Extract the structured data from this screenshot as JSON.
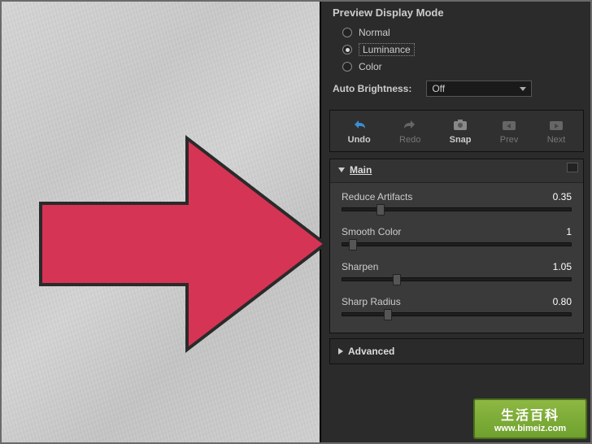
{
  "preview": {
    "title": "Preview Display Mode",
    "options": [
      "Normal",
      "Luminance",
      "Color"
    ],
    "selected": "Luminance",
    "auto_brightness_label": "Auto Brightness:",
    "auto_brightness_value": "Off"
  },
  "toolbar": {
    "undo": "Undo",
    "redo": "Redo",
    "snap": "Snap",
    "prev": "Prev",
    "next": "Next"
  },
  "main": {
    "title": "Main",
    "sliders": [
      {
        "label": "Reduce Artifacts",
        "value": "0.35",
        "pos": 15
      },
      {
        "label": "Smooth Color",
        "value": "1",
        "pos": 3
      },
      {
        "label": "Sharpen",
        "value": "1.05",
        "pos": 22
      },
      {
        "label": "Sharp Radius",
        "value": "0.80",
        "pos": 18
      }
    ]
  },
  "advanced": {
    "title": "Advanced"
  },
  "watermark": {
    "line1": "生活百科",
    "line2": "www.bimeiz.com"
  }
}
